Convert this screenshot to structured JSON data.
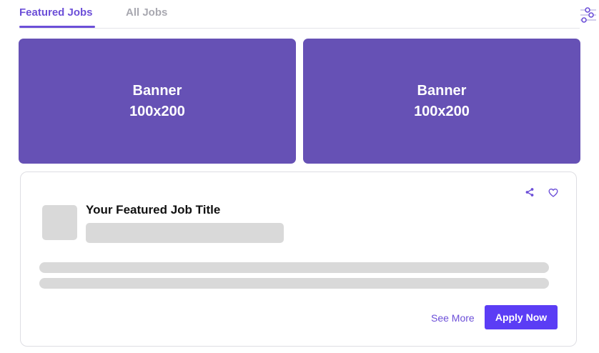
{
  "tabs": [
    {
      "label": "Featured Jobs",
      "active": true
    },
    {
      "label": "All Jobs",
      "active": false
    }
  ],
  "toolbar": {
    "filter_icon": "filter-sliders-icon"
  },
  "banners": [
    {
      "title": "Banner",
      "size": "100x200"
    },
    {
      "title": "Banner",
      "size": "100x200"
    }
  ],
  "job_card": {
    "title": "Your Featured Job Title",
    "share_icon": "share-icon",
    "favorite_icon": "heart-icon",
    "see_more_label": "See More",
    "apply_label": "Apply Now"
  },
  "colors": {
    "accent": "#6c4fd8",
    "banner": "#6651b5",
    "apply_button": "#5b3df5",
    "placeholder": "#d9d9d9",
    "inactive_tab": "#a8a8b0"
  }
}
